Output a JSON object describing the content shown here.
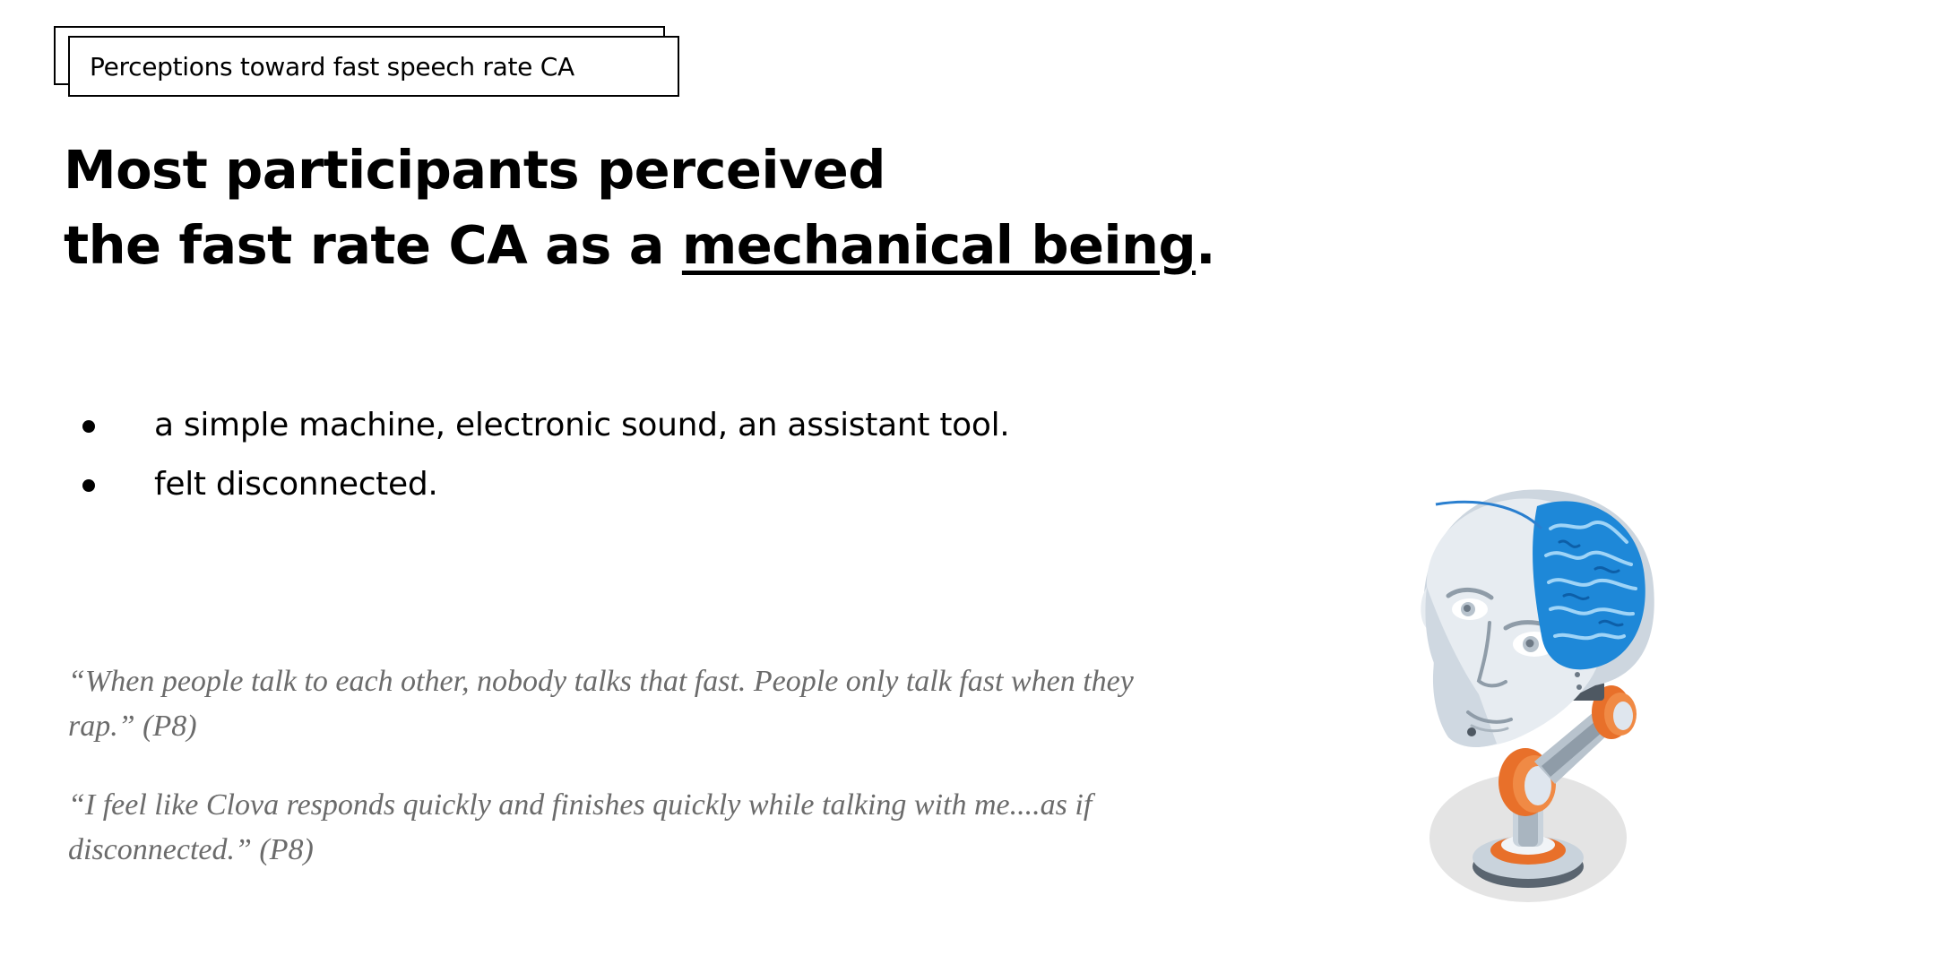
{
  "tag": {
    "label": "Perceptions toward fast speech rate CA"
  },
  "headline": {
    "line1": "Most participants perceived",
    "line2_prefix": "the fast rate CA as a ",
    "line2_emphasis": "mechanical being",
    "line2_suffix": "."
  },
  "bullets": [
    {
      "text": "a simple machine, electronic sound, an assistant tool."
    },
    {
      "text": "felt disconnected."
    }
  ],
  "quotes": [
    {
      "text": "“When people talk to each other, nobody talks that fast. People only talk fast when they rap.” (P8)"
    },
    {
      "text": "“I feel like Clova responds quickly and finishes quickly while talking with me....as if disconnected.” (P8)"
    }
  ],
  "illustration": {
    "icon": "robot-head-brain-illustration",
    "colors": {
      "brain": "#1e88d8",
      "head": "#dfe6ee",
      "joints": "#e8702a",
      "shadow": "#e4e4e4"
    }
  }
}
